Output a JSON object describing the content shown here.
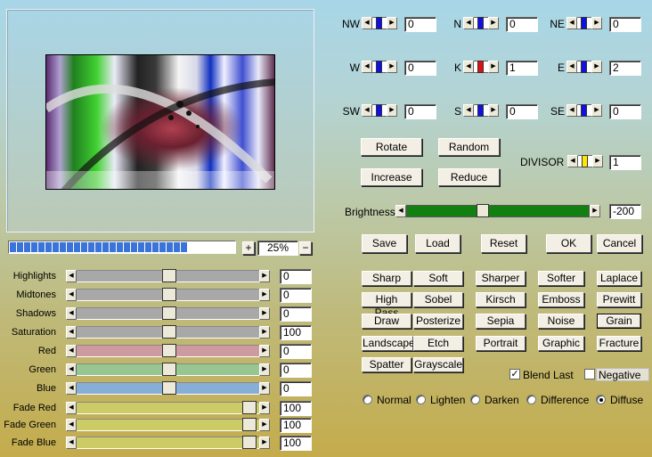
{
  "matrix": [
    {
      "label": "NW",
      "value": "0",
      "marker": "blue"
    },
    {
      "label": "N",
      "value": "0",
      "marker": "blue"
    },
    {
      "label": "NE",
      "value": "0",
      "marker": "blue"
    },
    {
      "label": "W",
      "value": "0",
      "marker": "blue"
    },
    {
      "label": "K",
      "value": "1",
      "marker": "red"
    },
    {
      "label": "E",
      "value": "2",
      "marker": "blue"
    },
    {
      "label": "SW",
      "value": "0",
      "marker": "blue"
    },
    {
      "label": "S",
      "value": "0",
      "marker": "blue"
    },
    {
      "label": "SE",
      "value": "0",
      "marker": "blue"
    }
  ],
  "actions": {
    "rotate": "Rotate",
    "random": "Random",
    "increase": "Increase",
    "reduce": "Reduce"
  },
  "divisor": {
    "label": "DIVISOR",
    "value": "1",
    "marker": "yellow"
  },
  "brightness": {
    "label": "Brightness",
    "value": "-200",
    "level_percent": 92
  },
  "dialog": {
    "save": "Save",
    "load": "Load",
    "reset": "Reset",
    "ok": "OK",
    "cancel": "Cancel"
  },
  "zoom": {
    "plus": "+",
    "value": "25%",
    "minus": "−",
    "progress_segments": 25
  },
  "sliders": [
    {
      "label": "Highlights",
      "value": "0",
      "track": "#a8a8a8",
      "pos": 0.5
    },
    {
      "label": "Midtones",
      "value": "0",
      "track": "#a8a8a8",
      "pos": 0.5
    },
    {
      "label": "Shadows",
      "value": "0",
      "track": "#a8a8a8",
      "pos": 0.5
    },
    {
      "label": "Saturation",
      "value": "100",
      "track": "#a8a8a8",
      "pos": 0.5
    },
    {
      "label": "Red",
      "value": "0",
      "track": "#cc9aa0",
      "pos": 0.5
    },
    {
      "label": "Green",
      "value": "0",
      "track": "#98c692",
      "pos": 0.5
    },
    {
      "label": "Blue",
      "value": "0",
      "track": "#86aed6",
      "pos": 0.5
    },
    {
      "label": "Fade Red",
      "value": "100",
      "track": "#cccc66",
      "pos": 1
    },
    {
      "label": "Fade Green",
      "value": "100",
      "track": "#cccc66",
      "pos": 1
    },
    {
      "label": "Fade Blue",
      "value": "100",
      "track": "#cccc66",
      "pos": 1
    }
  ],
  "presets": [
    "Sharp",
    "Soft",
    "Sharper",
    "Softer",
    "Laplace",
    "High Pass",
    "Sobel",
    "Kirsch",
    "Emboss",
    "Prewitt",
    "Draw",
    "Posterize",
    "Sepia",
    "Noise",
    "Grain",
    "Landscape",
    "Etch",
    "Portrait",
    "Graphic",
    "Fracture",
    "Spatter",
    "Grayscale"
  ],
  "selected_preset": "Grain",
  "options": {
    "blend_last": "Blend Last",
    "blend_last_checked": true,
    "negative": "Negative",
    "negative_checked": false
  },
  "modes": [
    "Normal",
    "Lighten",
    "Darken",
    "Difference",
    "Diffuse"
  ],
  "selected_mode": "Diffuse"
}
